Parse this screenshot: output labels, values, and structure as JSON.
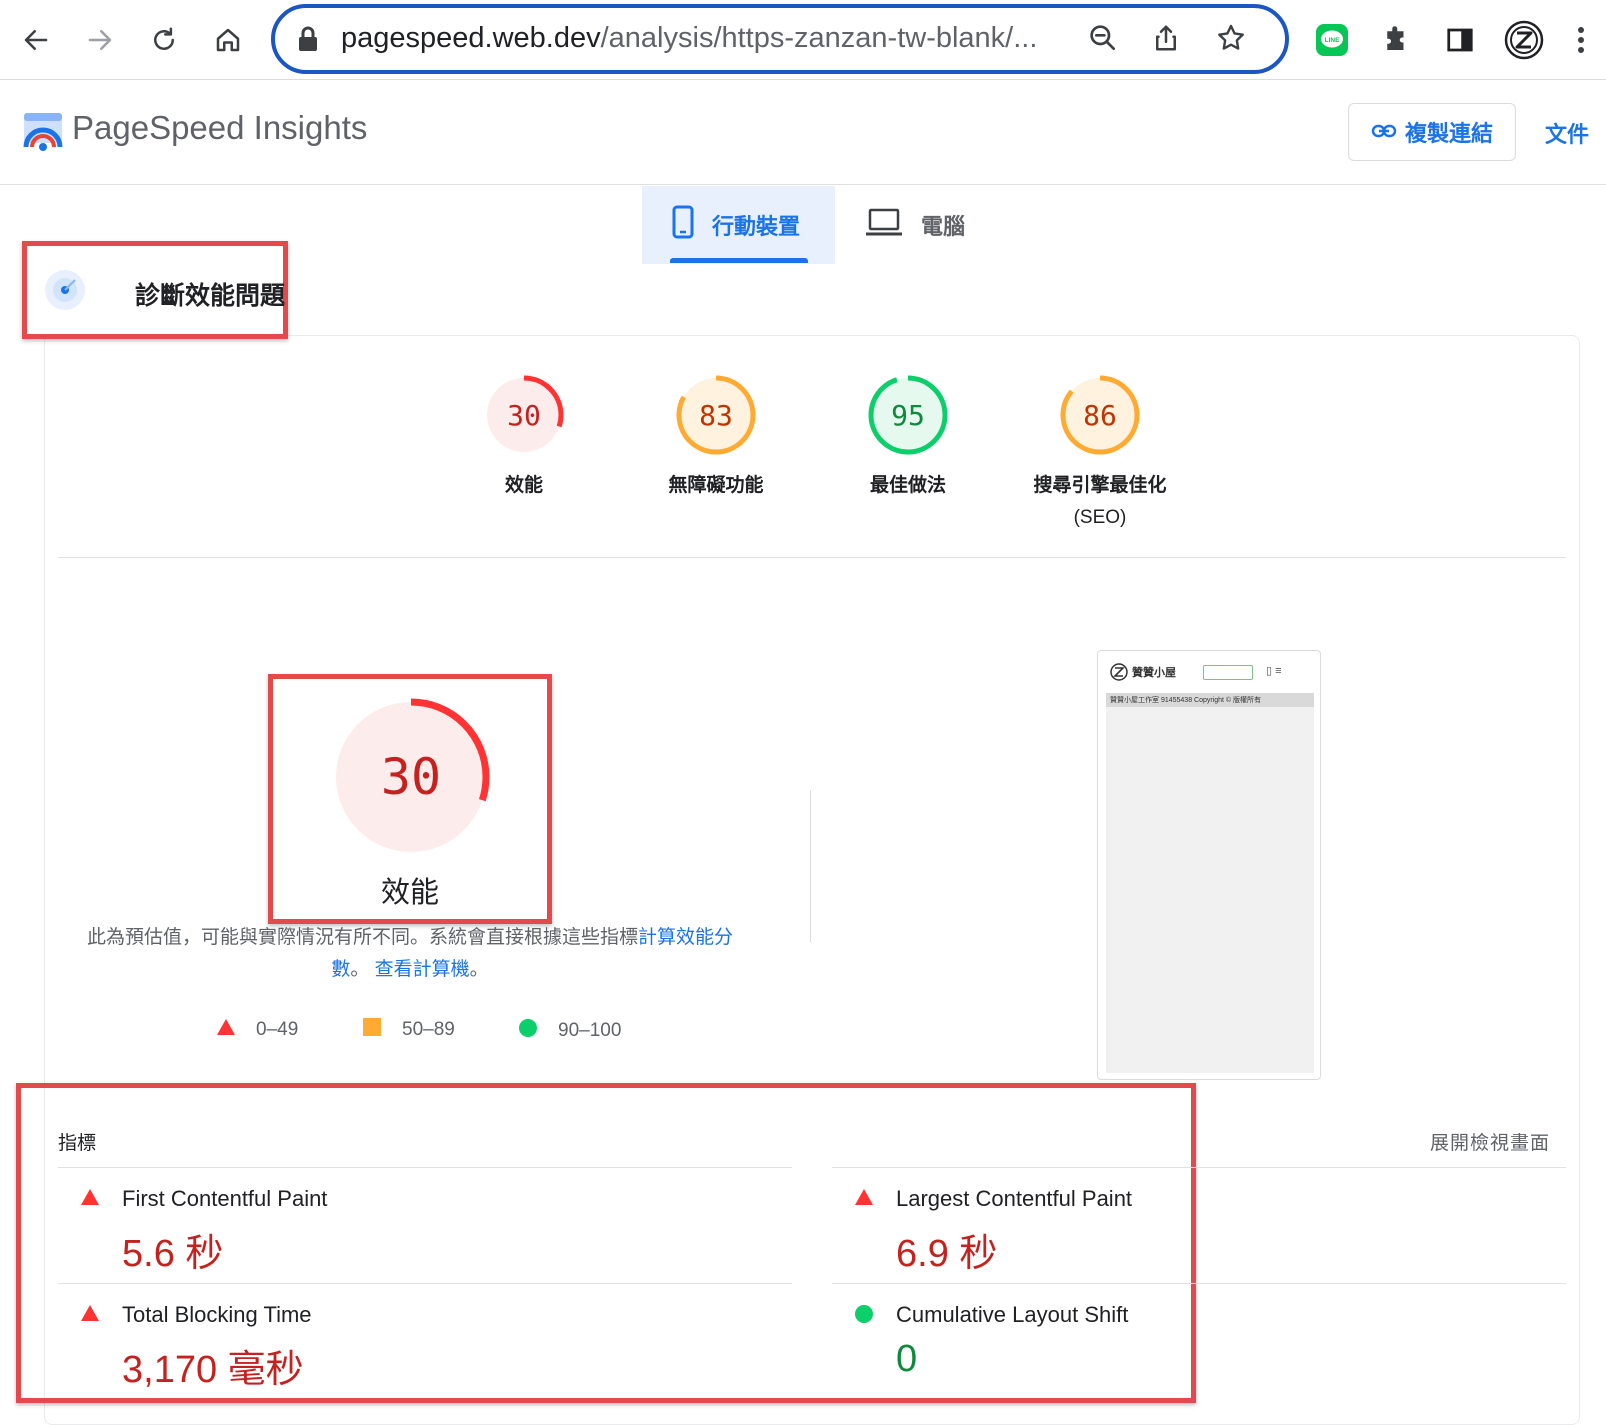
{
  "browser": {
    "url_host": "pagespeed.web.dev",
    "url_path": "/analysis/https-zanzan-tw-blank/..."
  },
  "header": {
    "brand": "PageSpeed Insights",
    "copy_link": "複製連結",
    "docs": "文件"
  },
  "tabs": {
    "mobile": "行動裝置",
    "desktop": "電腦"
  },
  "diagnose": {
    "label": "診斷效能問題"
  },
  "scores": [
    {
      "value": "30",
      "label": "效能",
      "label2": "",
      "status": "fail",
      "fraction": 0.3
    },
    {
      "value": "83",
      "label": "無障礙功能",
      "label2": "",
      "status": "average",
      "fraction": 0.83
    },
    {
      "value": "95",
      "label": "最佳做法",
      "label2": "",
      "status": "pass",
      "fraction": 0.95
    },
    {
      "value": "86",
      "label": "搜尋引擎最佳化",
      "label2": "(SEO)",
      "status": "average",
      "fraction": 0.86
    }
  ],
  "main_score": {
    "value": "30",
    "label": "效能",
    "fraction": 0.3
  },
  "description": {
    "text": "此為預估值，可能與實際情況有所不同。系統會直接根據這些指標",
    "link1": "計算效能分數",
    "sep": "。",
    "link2": "查看計算機",
    "end": "。"
  },
  "legend": {
    "fail": "0–49",
    "average": "50–89",
    "pass": "90–100"
  },
  "thumbnail": {
    "site_name": "贊贊小屋",
    "footer": "贊贊小屋工作室 91455438 Copyright © 版權所有"
  },
  "metrics": {
    "title": "指標",
    "expand": "展開檢視畫面",
    "items": {
      "fcp": {
        "name": "First Contentful Paint",
        "value": "5.6 秒",
        "status": "fail"
      },
      "lcp": {
        "name": "Largest Contentful Paint",
        "value": "6.9 秒",
        "status": "fail"
      },
      "tbt": {
        "name": "Total Blocking Time",
        "value": "3,170 毫秒",
        "status": "fail"
      },
      "cls": {
        "name": "Cumulative Layout Shift",
        "value": "0",
        "status": "pass"
      }
    }
  },
  "colors": {
    "fail": "#ff3333",
    "fail_text": "#c5221f",
    "fail_bg": "#fdecec",
    "average": "#ffaa33",
    "average_text": "#c33300",
    "average_bg": "#fff3e0",
    "pass": "#0cce6b",
    "pass_text": "#080",
    "pass_bg": "#e6f9ee",
    "accent": "#1a73e8",
    "highlight": "#e4494b"
  }
}
